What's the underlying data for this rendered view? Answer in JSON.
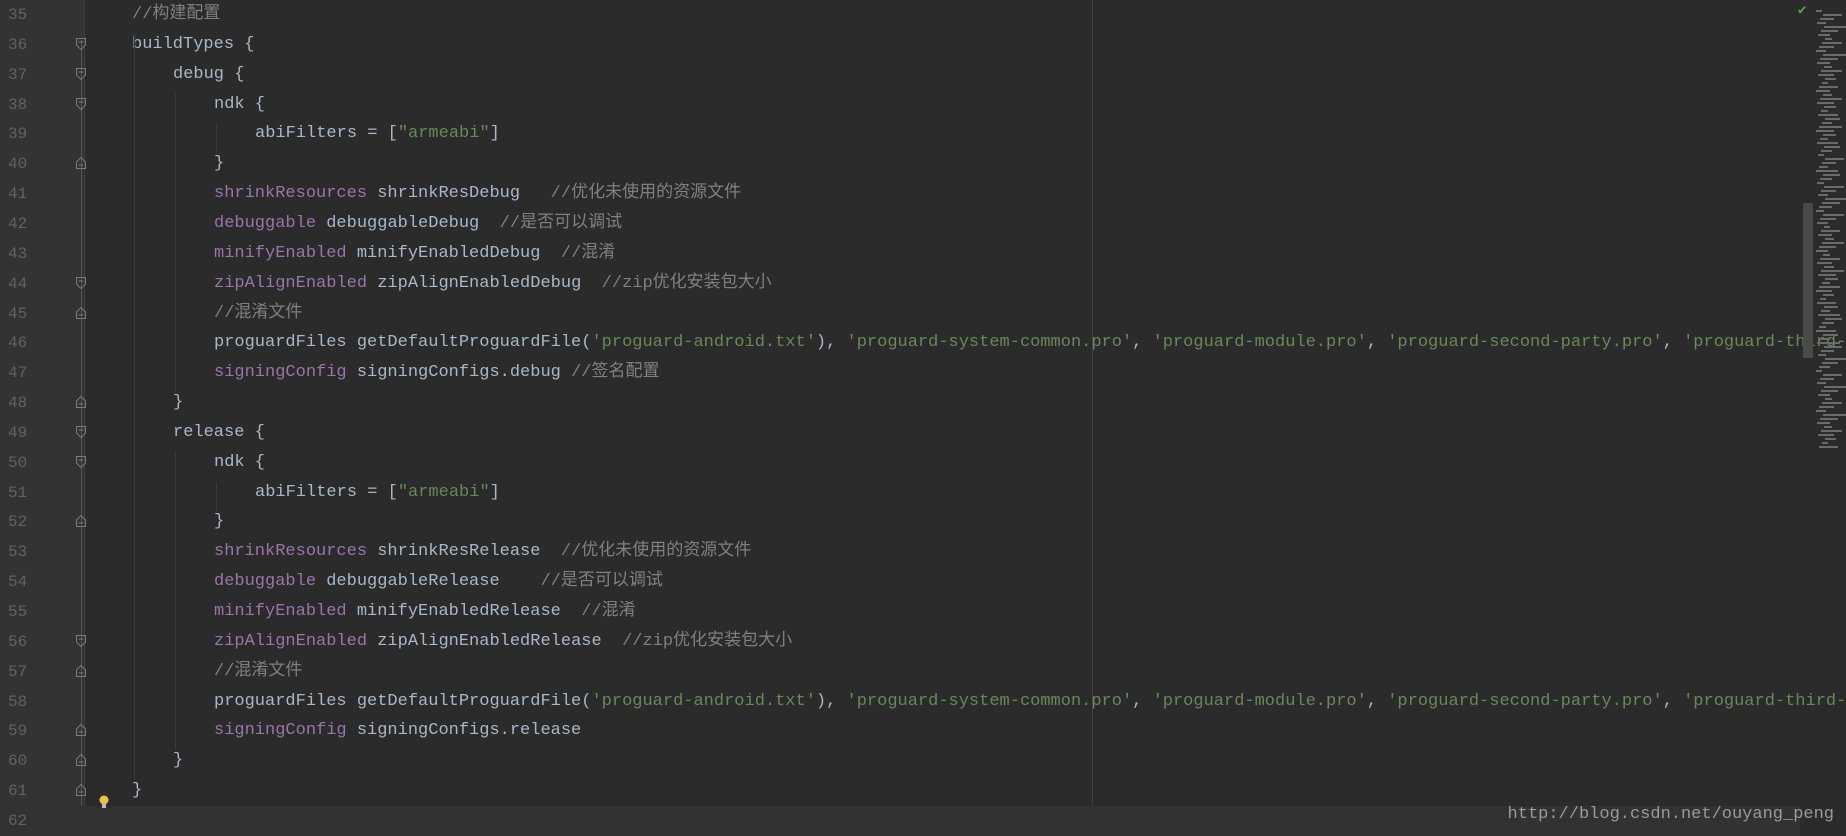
{
  "editor": {
    "lines": [
      {
        "n": "35",
        "fold": "",
        "t": [
          [
            "cm",
            "//构建配置"
          ]
        ],
        "i": 0
      },
      {
        "n": "36",
        "fold": "open",
        "t": [
          [
            "",
            "buildTypes {"
          ]
        ],
        "i": 0
      },
      {
        "n": "37",
        "fold": "open",
        "t": [
          [
            "",
            "debug {"
          ]
        ],
        "i": 1
      },
      {
        "n": "38",
        "fold": "open",
        "t": [
          [
            "",
            "ndk {"
          ]
        ],
        "i": 2
      },
      {
        "n": "39",
        "fold": "",
        "t": [
          [
            "",
            "abiFilters = ["
          ],
          [
            "str",
            "\"armeabi\""
          ],
          [
            "",
            "]"
          ]
        ],
        "i": 3
      },
      {
        "n": "40",
        "fold": "close",
        "t": [
          [
            "",
            "}"
          ]
        ],
        "i": 2
      },
      {
        "n": "41",
        "fold": "",
        "t": [
          [
            "kw",
            "shrinkResources"
          ],
          [
            "",
            " shrinkResDebug   "
          ],
          [
            "cm",
            "//优化未使用的资源文件"
          ]
        ],
        "i": 2
      },
      {
        "n": "42",
        "fold": "",
        "t": [
          [
            "kw",
            "debuggable"
          ],
          [
            "",
            " debuggableDebug  "
          ],
          [
            "cm",
            "//是否可以调试"
          ]
        ],
        "i": 2
      },
      {
        "n": "43",
        "fold": "",
        "t": [
          [
            "kw",
            "minifyEnabled"
          ],
          [
            "",
            " minifyEnabledDebug  "
          ],
          [
            "cm",
            "//混淆"
          ]
        ],
        "i": 2
      },
      {
        "n": "44",
        "fold": "open",
        "t": [
          [
            "kw",
            "zipAlignEnabled"
          ],
          [
            "",
            " zipAlignEnabledDebug  "
          ],
          [
            "cm",
            "//zip优化安装包大小"
          ]
        ],
        "i": 2
      },
      {
        "n": "45",
        "fold": "close",
        "t": [
          [
            "cm",
            "//混淆文件"
          ]
        ],
        "i": 2
      },
      {
        "n": "46",
        "fold": "",
        "t": [
          [
            "",
            "proguardFiles getDefaultProguardFile("
          ],
          [
            "str",
            "'proguard-android.txt'"
          ],
          [
            "",
            "), "
          ],
          [
            "str",
            "'proguard-system-common.pro'"
          ],
          [
            "",
            ", "
          ],
          [
            "str",
            "'proguard-module.pro'"
          ],
          [
            "",
            ", "
          ],
          [
            "str",
            "'proguard-second-party.pro'"
          ],
          [
            "",
            ", "
          ],
          [
            "str",
            "'proguard-third-"
          ]
        ],
        "i": 2
      },
      {
        "n": "47",
        "fold": "",
        "t": [
          [
            "kw",
            "signingConfig"
          ],
          [
            "",
            " signingConfigs.debug "
          ],
          [
            "cm",
            "//签名配置"
          ]
        ],
        "i": 2
      },
      {
        "n": "48",
        "fold": "close",
        "t": [
          [
            "",
            "}"
          ]
        ],
        "i": 1
      },
      {
        "n": "49",
        "fold": "open",
        "t": [
          [
            "",
            "release {"
          ]
        ],
        "i": 1
      },
      {
        "n": "50",
        "fold": "open",
        "t": [
          [
            "",
            "ndk {"
          ]
        ],
        "i": 2
      },
      {
        "n": "51",
        "fold": "",
        "t": [
          [
            "",
            "abiFilters = ["
          ],
          [
            "str",
            "\"armeabi\""
          ],
          [
            "",
            "]"
          ]
        ],
        "i": 3
      },
      {
        "n": "52",
        "fold": "close",
        "t": [
          [
            "",
            "}"
          ]
        ],
        "i": 2
      },
      {
        "n": "53",
        "fold": "",
        "t": [
          [
            "kw",
            "shrinkResources"
          ],
          [
            "",
            " shrinkResRelease  "
          ],
          [
            "cm",
            "//优化未使用的资源文件"
          ]
        ],
        "i": 2
      },
      {
        "n": "54",
        "fold": "",
        "t": [
          [
            "kw",
            "debuggable"
          ],
          [
            "",
            " debuggableRelease    "
          ],
          [
            "cm",
            "//是否可以调试"
          ]
        ],
        "i": 2
      },
      {
        "n": "55",
        "fold": "",
        "t": [
          [
            "kw",
            "minifyEnabled"
          ],
          [
            "",
            " minifyEnabledRelease  "
          ],
          [
            "cm",
            "//混淆"
          ]
        ],
        "i": 2
      },
      {
        "n": "56",
        "fold": "open",
        "t": [
          [
            "kw",
            "zipAlignEnabled"
          ],
          [
            "",
            " zipAlignEnabledRelease  "
          ],
          [
            "cm",
            "//zip优化安装包大小"
          ]
        ],
        "i": 2
      },
      {
        "n": "57",
        "fold": "close",
        "t": [
          [
            "cm",
            "//混淆文件"
          ]
        ],
        "i": 2
      },
      {
        "n": "58",
        "fold": "",
        "t": [
          [
            "",
            "proguardFiles getDefaultProguardFile("
          ],
          [
            "str",
            "'proguard-android.txt'"
          ],
          [
            "",
            "), "
          ],
          [
            "str",
            "'proguard-system-common.pro'"
          ],
          [
            "",
            ", "
          ],
          [
            "str",
            "'proguard-module.pro'"
          ],
          [
            "",
            ", "
          ],
          [
            "str",
            "'proguard-second-party.pro'"
          ],
          [
            "",
            ", "
          ],
          [
            "str",
            "'proguard-third-"
          ]
        ],
        "i": 2
      },
      {
        "n": "59",
        "fold": "close",
        "t": [
          [
            "kw",
            "signingConfig"
          ],
          [
            "",
            " signingConfigs.release"
          ]
        ],
        "i": 2
      },
      {
        "n": "60",
        "fold": "close",
        "t": [
          [
            "",
            "}"
          ]
        ],
        "i": 1
      },
      {
        "n": "61",
        "fold": "close",
        "t": [
          [
            "",
            "}"
          ]
        ],
        "i": 0
      },
      {
        "n": "62",
        "fold": "",
        "t": [],
        "i": 0
      }
    ],
    "current_line": "62"
  },
  "watermark": "http://blog.csdn.net/ouyang_peng",
  "icons": {
    "fold": "fold-marker-icon",
    "bulb": "lightbulb-icon",
    "check": "inspection-ok-icon"
  },
  "colors": {
    "bg": "#2b2b2b",
    "keyword": "#9876aa",
    "string": "#6a8759",
    "comment": "#808080",
    "text": "#a9b7c6"
  }
}
